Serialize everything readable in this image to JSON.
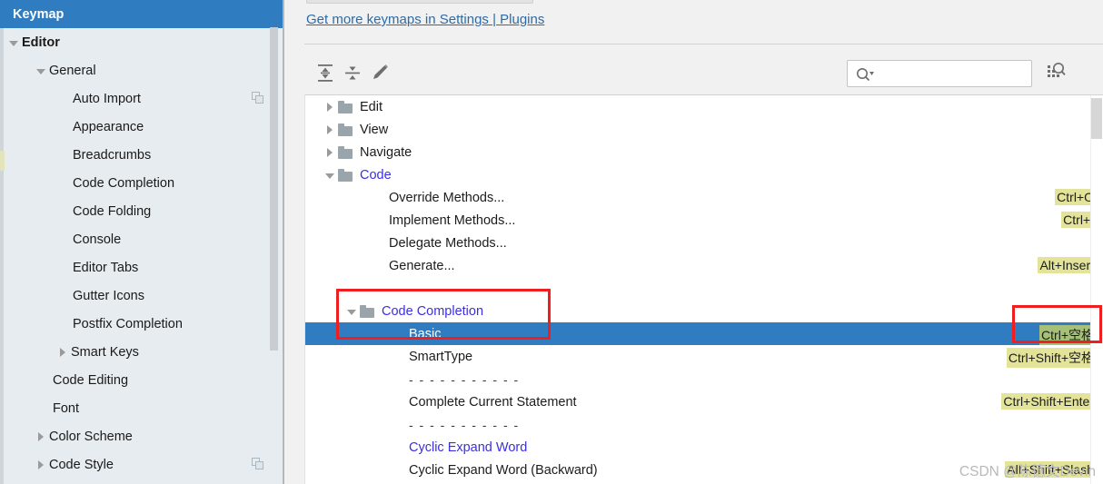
{
  "sidebar": {
    "selected_label": "Keymap",
    "items": [
      {
        "label": "Keymap",
        "indent": 14,
        "tri": "none",
        "bold": true,
        "selected": true,
        "copy": false
      },
      {
        "label": "Editor",
        "indent": 8,
        "tri": "down",
        "bold": true,
        "selected": false,
        "copy": false
      },
      {
        "label": "General",
        "indent": 38,
        "tri": "down",
        "bold": false,
        "selected": false,
        "copy": false
      },
      {
        "label": "Auto Import",
        "indent": 80,
        "tri": "none",
        "bold": false,
        "selected": false,
        "copy": true
      },
      {
        "label": "Appearance",
        "indent": 80,
        "tri": "none",
        "bold": false,
        "selected": false,
        "copy": false
      },
      {
        "label": "Breadcrumbs",
        "indent": 80,
        "tri": "none",
        "bold": false,
        "selected": false,
        "copy": false
      },
      {
        "label": "Code Completion",
        "indent": 80,
        "tri": "none",
        "bold": false,
        "selected": false,
        "copy": false
      },
      {
        "label": "Code Folding",
        "indent": 80,
        "tri": "none",
        "bold": false,
        "selected": false,
        "copy": false
      },
      {
        "label": "Console",
        "indent": 80,
        "tri": "none",
        "bold": false,
        "selected": false,
        "copy": false
      },
      {
        "label": "Editor Tabs",
        "indent": 80,
        "tri": "none",
        "bold": false,
        "selected": false,
        "copy": false
      },
      {
        "label": "Gutter Icons",
        "indent": 80,
        "tri": "none",
        "bold": false,
        "selected": false,
        "copy": false
      },
      {
        "label": "Postfix Completion",
        "indent": 80,
        "tri": "none",
        "bold": false,
        "selected": false,
        "copy": false
      },
      {
        "label": "Smart Keys",
        "indent": 62,
        "tri": "right",
        "bold": false,
        "selected": false,
        "copy": false
      },
      {
        "label": "Code Editing",
        "indent": 58,
        "tri": "none",
        "bold": false,
        "selected": false,
        "copy": false
      },
      {
        "label": "Font",
        "indent": 58,
        "tri": "none",
        "bold": false,
        "selected": false,
        "copy": false
      },
      {
        "label": "Color Scheme",
        "indent": 38,
        "tri": "right",
        "bold": false,
        "selected": false,
        "copy": false
      },
      {
        "label": "Code Style",
        "indent": 38,
        "tri": "right",
        "bold": false,
        "selected": false,
        "copy": true
      }
    ]
  },
  "header": {
    "plugins_link": "Get more keymaps in Settings | Plugins"
  },
  "toolbar": {
    "expand_all_title": "Expand All",
    "collapse_all_title": "Collapse All",
    "edit_title": "Edit Shortcut",
    "find_by_shortcut_title": "Find Actions by Shortcut"
  },
  "search": {
    "value": "",
    "placeholder": ""
  },
  "tree": {
    "rows": [
      {
        "kind": "folder",
        "label": "Edit",
        "tri": "right",
        "indent": 20,
        "blue": false,
        "shortcut": "",
        "selected": false
      },
      {
        "kind": "folder",
        "label": "View",
        "tri": "right",
        "indent": 20,
        "blue": false,
        "shortcut": "",
        "selected": false
      },
      {
        "kind": "folder",
        "label": "Navigate",
        "tri": "right",
        "indent": 20,
        "blue": false,
        "shortcut": "",
        "selected": false
      },
      {
        "kind": "folder",
        "label": "Code",
        "tri": "down",
        "indent": 20,
        "blue": true,
        "shortcut": "",
        "selected": false
      },
      {
        "kind": "action",
        "label": "Override Methods...",
        "tri": "none",
        "indent": 92,
        "blue": false,
        "shortcut": "Ctrl+O",
        "selected": false
      },
      {
        "kind": "action",
        "label": "Implement Methods...",
        "tri": "none",
        "indent": 92,
        "blue": false,
        "shortcut": "Ctrl+I",
        "selected": false
      },
      {
        "kind": "action",
        "label": "Delegate Methods...",
        "tri": "none",
        "indent": 92,
        "blue": false,
        "shortcut": "",
        "selected": false
      },
      {
        "kind": "action",
        "label": "Generate...",
        "tri": "none",
        "indent": 92,
        "blue": false,
        "shortcut": "Alt+Insert",
        "selected": false
      },
      {
        "kind": "separator",
        "label": "- - - - - - - - - - -",
        "tri": "none",
        "indent": 92,
        "blue": false,
        "shortcut": "",
        "selected": false
      },
      {
        "kind": "folder",
        "label": "Code Completion",
        "tri": "down",
        "indent": 44,
        "blue": true,
        "shortcut": "",
        "selected": false
      },
      {
        "kind": "action",
        "label": "Basic",
        "tri": "none",
        "indent": 114,
        "blue": false,
        "shortcut": "Ctrl+空格",
        "selected": true
      },
      {
        "kind": "action",
        "label": "SmartType",
        "tri": "none",
        "indent": 114,
        "blue": false,
        "shortcut": "Ctrl+Shift+空格",
        "selected": false
      },
      {
        "kind": "separator",
        "label": "- - - - - - - - - - -",
        "tri": "none",
        "indent": 114,
        "blue": false,
        "shortcut": "",
        "selected": false
      },
      {
        "kind": "action",
        "label": "Complete Current Statement",
        "tri": "none",
        "indent": 114,
        "blue": false,
        "shortcut": "Ctrl+Shift+Enter",
        "selected": false
      },
      {
        "kind": "separator",
        "label": "- - - - - - - - - - -",
        "tri": "none",
        "indent": 114,
        "blue": false,
        "shortcut": "",
        "selected": false
      },
      {
        "kind": "action",
        "label": "Cyclic Expand Word",
        "tri": "none",
        "indent": 114,
        "blue": true,
        "shortcut": "",
        "selected": false
      },
      {
        "kind": "action",
        "label": "Cyclic Expand Word (Backward)",
        "tri": "none",
        "indent": 114,
        "blue": false,
        "shortcut": "Alt+Shift+Slash",
        "selected": false
      }
    ]
  },
  "annotations": {
    "box_tree_label": "highlight-code-completion-basic",
    "box_shortcut_label": "highlight-basic-shortcut"
  },
  "watermark": "CSDN @陈德文Devin",
  "colors": {
    "selection_blue": "#2f7cc0",
    "link_blue": "#2d6ba8",
    "tree_blue_text": "#3b2fe0",
    "shortcut_bg": "#e3e39a",
    "shortcut_bg_selected": "#a6c07a",
    "annotation_red": "#f01e1e",
    "sidebar_bg": "#e7ecf0"
  }
}
